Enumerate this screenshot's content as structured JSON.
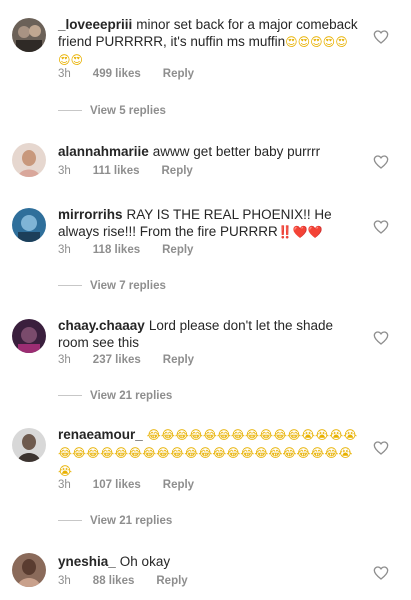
{
  "comments": [
    {
      "username": "_loveeepriii",
      "text": "minor set back for a major comeback friend PURRRRR, it's nuffin ms muffin",
      "emoji": "😍😍😍😍😍😍😍",
      "time": "3h",
      "likes": "499 likes",
      "reply": "Reply",
      "view_replies": "View 5 replies"
    },
    {
      "username": "alannahmariie",
      "text": "awww get better baby purrrr",
      "time": "3h",
      "likes": "111 likes",
      "reply": "Reply"
    },
    {
      "username": "mirrorrihs",
      "text": "RAY IS THE REAL PHOENIX!! He always rise!!! From the fire PURRRR",
      "emoji": "‼️❤️❤️",
      "time": "3h",
      "likes": "118 likes",
      "reply": "Reply",
      "view_replies": "View 7 replies"
    },
    {
      "username": "chaay.chaaay",
      "text": "Lord please don't let the shade room see this",
      "time": "3h",
      "likes": "237 likes",
      "reply": "Reply",
      "view_replies": "View 21 replies"
    },
    {
      "username": "renaeamour_",
      "emoji": "😂😂😂😂😂😂😂😂😂😂😂😭😭😭😭😂😂😂😂😂😂😂😂😂😂😂😂😂😂😂😂😂😂😂😂😭😭",
      "time": "3h",
      "likes": "107 likes",
      "reply": "Reply",
      "view_replies": "View 21 replies"
    },
    {
      "username": "yneshia_",
      "text": "Oh okay",
      "time": "3h",
      "likes": "88 likes",
      "reply": "Reply"
    }
  ],
  "colors": {
    "text": "#262626",
    "muted": "#8e8e8e",
    "divider": "#c7c7c7"
  }
}
